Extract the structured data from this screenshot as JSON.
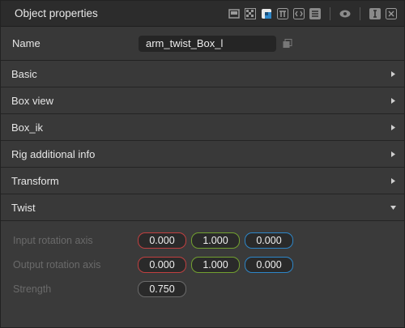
{
  "panel": {
    "title": "Object properties",
    "toolbar_icons": [
      "monitor-icon",
      "checker-icon",
      "color-cube-icon",
      "pi-icon",
      "code-icon",
      "list-icon",
      "eye-icon",
      "text-cursor-icon",
      "text-format-icon"
    ]
  },
  "name_row": {
    "label": "Name",
    "value": "arm_twist_Box_l"
  },
  "sections": [
    {
      "label": "Basic",
      "expanded": false
    },
    {
      "label": "Box view",
      "expanded": false
    },
    {
      "label": "Box_ik",
      "expanded": false
    },
    {
      "label": "Rig additional info",
      "expanded": false
    },
    {
      "label": "Transform",
      "expanded": false
    },
    {
      "label": "Twist",
      "expanded": true
    }
  ],
  "twist": {
    "input_rotation_axis": {
      "label": "Input rotation axis",
      "x": "0.000",
      "y": "1.000",
      "z": "0.000"
    },
    "output_rotation_axis": {
      "label": "Output rotation axis",
      "x": "0.000",
      "y": "1.000",
      "z": "0.000"
    },
    "strength": {
      "label": "Strength",
      "value": "0.750"
    }
  },
  "colors": {
    "x_axis": "#c04040",
    "y_axis": "#72a030",
    "z_axis": "#2d86c8",
    "accent": "#2d86c8"
  }
}
